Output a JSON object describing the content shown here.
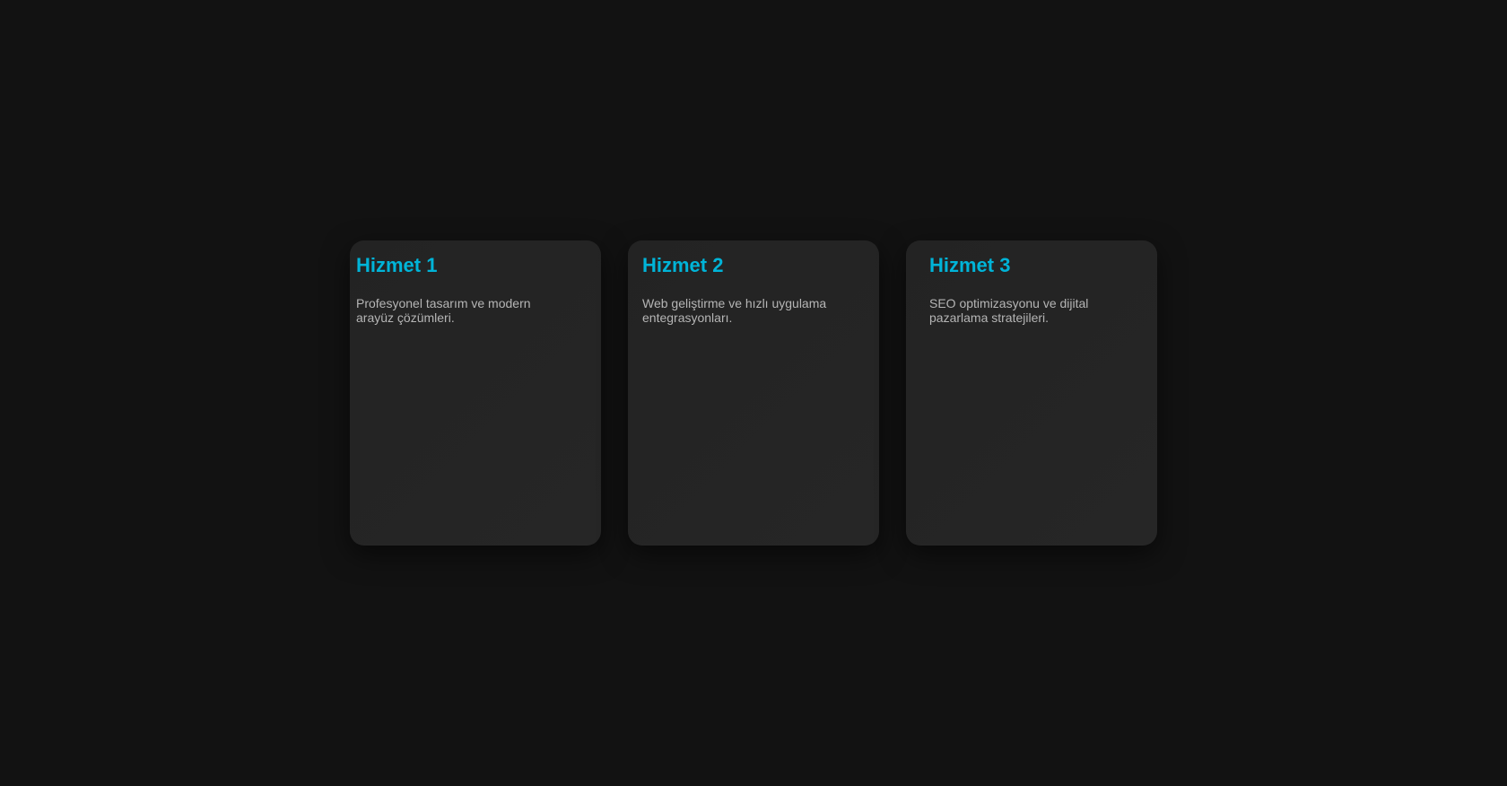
{
  "colors": {
    "background": "#121212",
    "card": "#242424",
    "title": "#00b4d8",
    "text": "#b5b5b5"
  },
  "services": [
    {
      "title": "Hizmet 1",
      "description": "Profesyonel tasarım ve modern arayüz çözümleri."
    },
    {
      "title": "Hizmet 2",
      "description": "Web geliştirme ve hızlı uygulama entegrasyonları."
    },
    {
      "title": "Hizmet 3",
      "description": "SEO optimizasyonu ve dijital pazarlama stratejileri."
    }
  ]
}
